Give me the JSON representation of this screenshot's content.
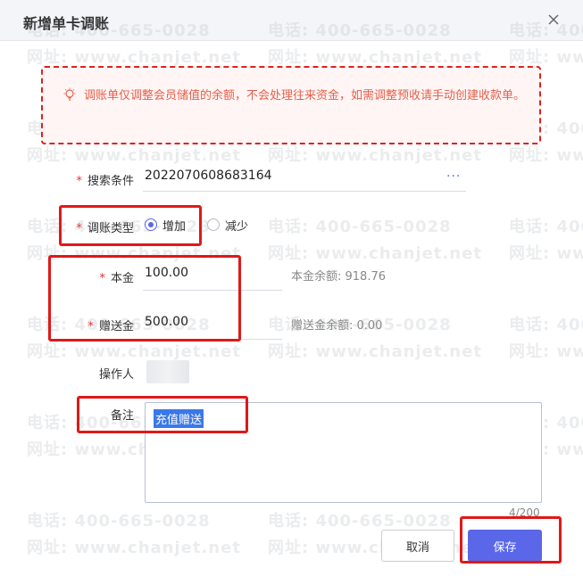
{
  "dialog": {
    "title": "新增单卡调账"
  },
  "watermark": {
    "phone": "电话: 400-665-0028",
    "site": "网址: www.chanjet.net"
  },
  "notice": {
    "text": "调账单仅调整会员储值的余额，不会处理往来资金，如需调整预收请手动创建收款单。"
  },
  "form": {
    "search": {
      "label": "搜索条件",
      "value": "2022070608683164",
      "more": "···"
    },
    "type": {
      "label": "调账类型",
      "options": [
        "增加",
        "减少"
      ],
      "selected": "增加"
    },
    "principal": {
      "label": "本金",
      "value": "100.00",
      "balance": "本金余额: 918.76"
    },
    "gift": {
      "label": "赠送金",
      "value": "500.00",
      "balance": "赠送金余额: 0.00"
    },
    "operator": {
      "label": "操作人"
    },
    "remark": {
      "label": "备注",
      "value": "充值赠送",
      "counter": "4/200"
    }
  },
  "buttons": {
    "cancel": "取消",
    "save": "保存"
  },
  "colors": {
    "accent": "#5a67e8",
    "annotation": "#e01818",
    "notice_text": "#e6604a"
  }
}
